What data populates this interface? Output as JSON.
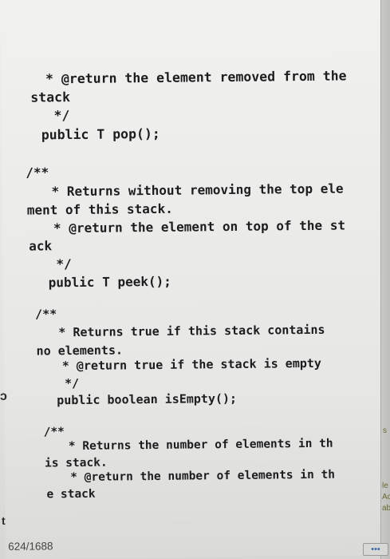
{
  "code_lines": {
    "l1": "* @return the element removed from the",
    "l2": "stack",
    "l3": "*/",
    "l4": "public T pop();",
    "l5": "/**",
    "l6": "* Returns without removing the top ele",
    "l7": "ment of this stack.",
    "l8": "* @return the element on top of the st",
    "l9": "ack",
    "l10": "*/",
    "l11": "public T peek();",
    "l12": "/**",
    "l13": "* Returns true if this stack contains",
    "l14": "no elements.",
    "l15": "* @return true if the stack is empty",
    "l16": "*/",
    "l17": "public boolean isEmpty();",
    "l18": "/**",
    "l19": "* Returns the number of elements in th",
    "l20": "is stack.",
    "l21": "* @return the number of elements in th",
    "l22": "e stack"
  },
  "footer": {
    "page_indicator": "624/1688"
  },
  "edge_marks": {
    "left_mid": "ↄ",
    "left_bottom": "t"
  },
  "side_fragments": {
    "s1": "s",
    "s2": "le",
    "s3": "Ac",
    "s4": "ab"
  },
  "menu_button": {
    "label": "•••"
  },
  "colors": {
    "text": "#1d1d1f",
    "page_background": "#ebebe9",
    "menu_accent": "#3a6aa8"
  }
}
